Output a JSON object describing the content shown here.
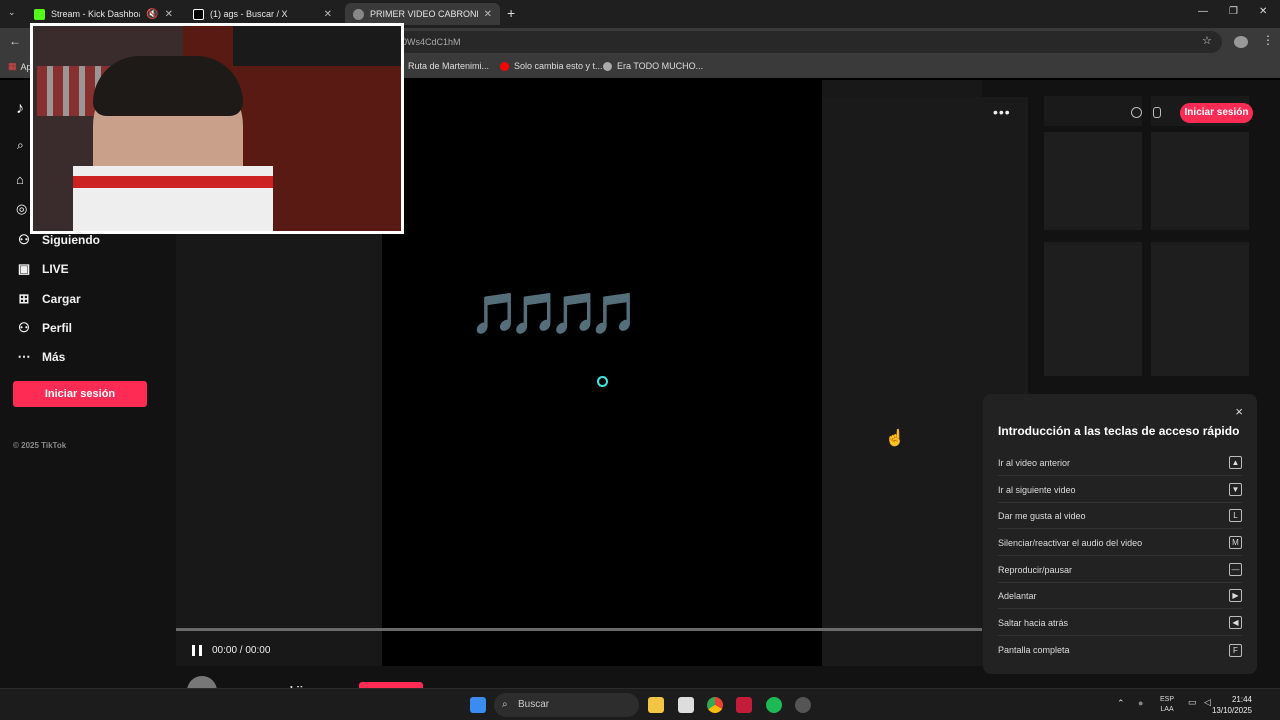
{
  "browser": {
    "tabs": [
      {
        "label": "Stream - Kick Dashboard",
        "favicon_color": "#53fc18"
      },
      {
        "label": "(1) ags - Buscar / X",
        "favicon_color": "#ffffff"
      },
      {
        "label": "PRIMER VIDEO CABRONES lo d",
        "favicon_color": "#cccccc"
      }
    ],
    "new_tab": "+",
    "url": "0Ws4CdC1hM",
    "bookmarks": [
      {
        "label": "Ap"
      },
      {
        "label": "Ruta de Martenimi..."
      },
      {
        "label": "Solo cambia esto y t..."
      },
      {
        "label": "Era TODO MUCHO..."
      }
    ]
  },
  "sidebar": {
    "items": [
      {
        "label": "Siguiendo",
        "icon": "person-icon"
      },
      {
        "label": "LIVE",
        "icon": "live-icon"
      },
      {
        "label": "Cargar",
        "icon": "plus-square-icon"
      },
      {
        "label": "Perfil",
        "icon": "person-icon"
      },
      {
        "label": "Más",
        "icon": "more-icon"
      }
    ],
    "login": "Iniciar sesión",
    "copyright": "© 2025 TikTok"
  },
  "player": {
    "time": "00:00 / 00:00",
    "notes": "🎵🎵🎵🎵",
    "username": "amo.a.moskii"
  },
  "header": {
    "login": "Iniciar sesión"
  },
  "shortcuts": {
    "title": "Introducción a las teclas de acceso rápido",
    "close": "×",
    "rows": [
      {
        "label": "Ir al video anterior",
        "key": "▲"
      },
      {
        "label": "Ir al siguiente video",
        "key": "▼"
      },
      {
        "label": "Dar me gusta al video",
        "key": "L"
      },
      {
        "label": "Silenciar/reactivar el audio del video",
        "key": "M"
      },
      {
        "label": "Reproducir/pausar",
        "key": "—"
      },
      {
        "label": "Adelantar",
        "key": "▶"
      },
      {
        "label": "Saltar hacia atrás",
        "key": "◀"
      },
      {
        "label": "Pantalla completa",
        "key": "F"
      }
    ]
  },
  "taskbar": {
    "search": "Buscar",
    "lang_top": "ESP",
    "lang_bottom": "LAA",
    "time": "21:44",
    "date": "13/10/2025"
  },
  "colors": {
    "accent": "#fe2c55"
  }
}
